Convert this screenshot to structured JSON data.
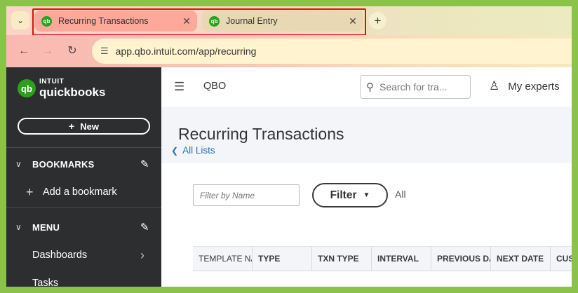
{
  "browser": {
    "tabs": [
      {
        "label": "Recurring Transactions",
        "favicon": "qb",
        "active": true
      },
      {
        "label": "Journal Entry",
        "favicon": "qb",
        "active": false
      }
    ],
    "close_glyph": "✕",
    "url": "app.qbo.intuit.com/app/recurring"
  },
  "sidebar": {
    "logo": {
      "intuit": "INTUIT",
      "product": "quickbooks",
      "badge": "qb"
    },
    "new_label": "New",
    "sections": [
      {
        "label": "BOOKMARKS",
        "items": [
          {
            "label": "Add a bookmark"
          }
        ]
      },
      {
        "label": "MENU",
        "items": [
          {
            "label": "Dashboards"
          },
          {
            "label": "Tasks"
          }
        ]
      }
    ]
  },
  "topbar": {
    "company": "QBO",
    "search_placeholder": "Search for tra...",
    "experts_label": "My experts"
  },
  "page": {
    "title": "Recurring Transactions",
    "back_link": "All Lists",
    "filter_placeholder": "Filter by Name",
    "filter_button": "Filter",
    "all_label": "All"
  },
  "table": {
    "columns": [
      "TEMPLATE NA",
      "TYPE",
      "TXN TYPE",
      "INTERVAL",
      "PREVIOUS DA",
      "NEXT DATE",
      "CUST"
    ]
  },
  "colors": {
    "brand_green": "#2ca01c",
    "sidebar_bg": "#2d2e30",
    "link_blue": "#2a6fb5",
    "highlight_red": "#e01010"
  }
}
